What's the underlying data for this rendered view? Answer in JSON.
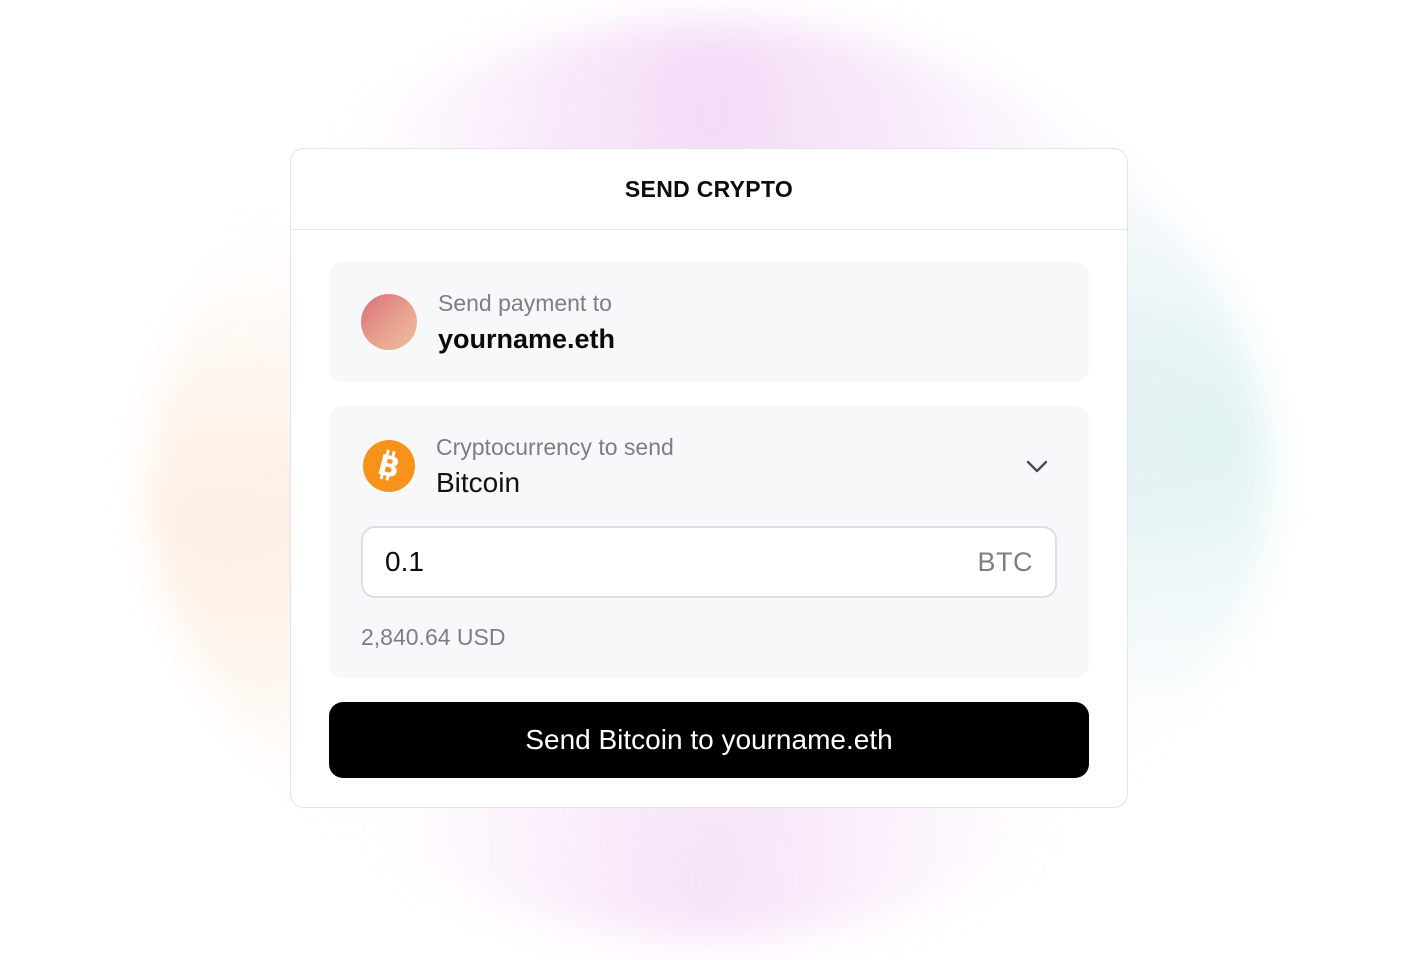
{
  "header": {
    "title": "SEND CRYPTO"
  },
  "recipient": {
    "label": "Send payment to",
    "name": "yourname.eth",
    "avatar_colors": [
      "#d9707a",
      "#efbd9e"
    ]
  },
  "crypto": {
    "label": "Cryptocurrency to send",
    "selected": "Bitcoin",
    "icon": "bitcoin-icon",
    "icon_color": "#f7931a",
    "dropdown_icon": "chevron-down-icon"
  },
  "amount": {
    "value": "0.1",
    "unit": "BTC",
    "usd_value": "2,840.64 USD"
  },
  "action": {
    "send_label": "Send Bitcoin to yourname.eth",
    "background": "#000000"
  }
}
